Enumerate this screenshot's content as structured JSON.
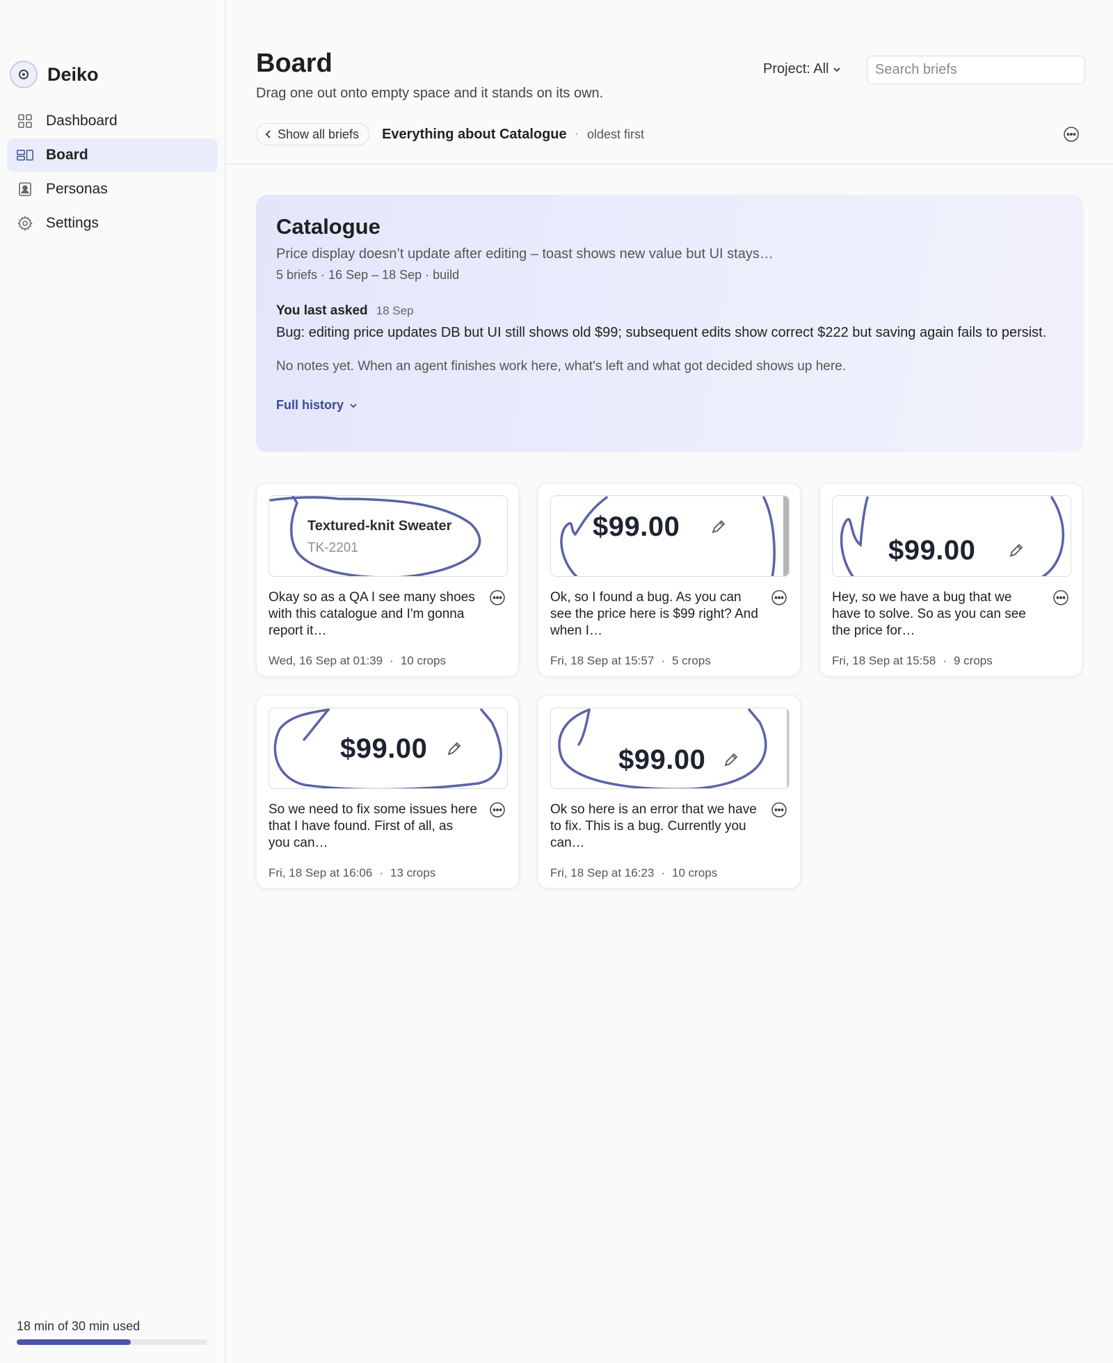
{
  "app": {
    "name": "Deiko"
  },
  "sidebar": {
    "items": [
      {
        "label": "Dashboard",
        "icon": "grid-icon",
        "active": false
      },
      {
        "label": "Board",
        "icon": "board-icon",
        "active": true
      },
      {
        "label": "Personas",
        "icon": "person-icon",
        "active": false
      },
      {
        "label": "Settings",
        "icon": "gear-icon",
        "active": false
      }
    ],
    "usage": {
      "label": "18 min of 30 min used",
      "used_minutes": 18,
      "total_minutes": 30
    }
  },
  "header": {
    "title": "Board",
    "subtitle": "Drag one out onto empty space and it stands on its own.",
    "project_filter": "Project: All",
    "search_placeholder": "Search briefs"
  },
  "toolbar": {
    "back_label": "Show all briefs",
    "filter_title": "Everything about Catalogue",
    "separator": "·",
    "sort_label": "oldest first"
  },
  "summary": {
    "title": "Catalogue",
    "description": "Price display doesn’t update after editing – toast shows new value but UI stays…",
    "meta": "5 briefs · 16 Sep – 18 Sep · build",
    "asked_label": "You last asked",
    "asked_date": "18 Sep",
    "asked_text": "Bug: editing price updates DB but UI still shows old $99; subsequent edits show correct $222 but saving again fails to persist.",
    "notes": "No notes yet. When an agent finishes work here, what's left and what got decided shows up here.",
    "history_label": "Full history"
  },
  "cards": [
    {
      "text": "Okay so as a QA I see many shoes with this catalogue and I'm gonna report it…",
      "date": "Wed, 16 Sep at 01:39",
      "crops": "10 crops",
      "thumb": {
        "kind": "product",
        "name": "Textured-knit Sweater",
        "sku": "TK-2201"
      }
    },
    {
      "text": "Ok, so I found a bug. As you can see the price here is $99 right? And when I…",
      "date": "Fri, 18 Sep at 15:57",
      "crops": "5 crops",
      "thumb": {
        "kind": "price",
        "price": "$99.00"
      }
    },
    {
      "text": "Hey, so we have a bug that we have to solve. So as you can see the price for…",
      "date": "Fri, 18 Sep at 15:58",
      "crops": "9 crops",
      "thumb": {
        "kind": "price",
        "price": "$99.00"
      }
    },
    {
      "text": "So we need to fix some issues here that I have found. First of all, as you can…",
      "date": "Fri, 18 Sep at 16:06",
      "crops": "13 crops",
      "thumb": {
        "kind": "price",
        "price": "$99.00"
      }
    },
    {
      "text": "Ok so here is an error that we have to fix. This is a bug. Currently you can…",
      "date": "Fri, 18 Sep at 16:23",
      "crops": "10 crops",
      "thumb": {
        "kind": "price",
        "price": "$99.00"
      }
    }
  ],
  "colors": {
    "accent": "#4a55a8",
    "active_nav_bg": "#e9ecfb",
    "annotation_stroke": "#5a63a8"
  }
}
